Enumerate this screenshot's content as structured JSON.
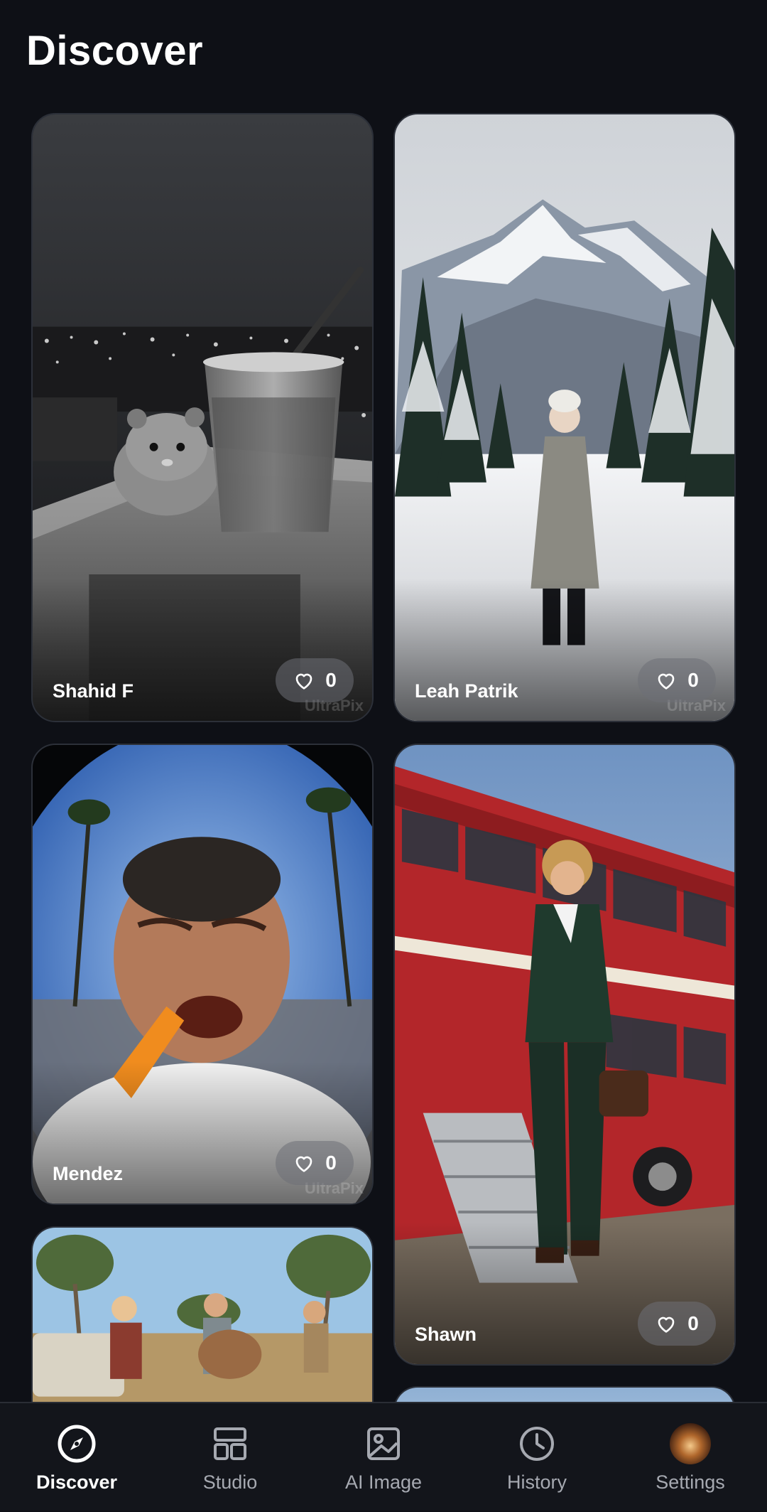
{
  "page": {
    "title": "Discover"
  },
  "feed": {
    "cards": [
      {
        "author": "Shahid F",
        "likes": "0",
        "watermark": "UltraPix"
      },
      {
        "author": "Leah Patrik",
        "likes": "0",
        "watermark": "UltraPix"
      },
      {
        "author": "Mendez",
        "likes": "0",
        "watermark": "UltraPix"
      },
      {
        "author": "Shawn",
        "likes": "0",
        "watermark": ""
      }
    ]
  },
  "bottom_nav": {
    "items": [
      {
        "label": "Discover",
        "icon": "compass-icon",
        "active": true
      },
      {
        "label": "Studio",
        "icon": "layout-grid-icon"
      },
      {
        "label": "AI Image",
        "icon": "image-icon"
      },
      {
        "label": "History",
        "icon": "clock-icon"
      },
      {
        "label": "Settings",
        "icon": "avatar"
      }
    ]
  },
  "colors": {
    "background": "#0e1016",
    "nav_background": "#13151b",
    "text_primary": "#ffffff",
    "text_secondary": "#a6a9b1",
    "like_pill": "#6e7076"
  }
}
